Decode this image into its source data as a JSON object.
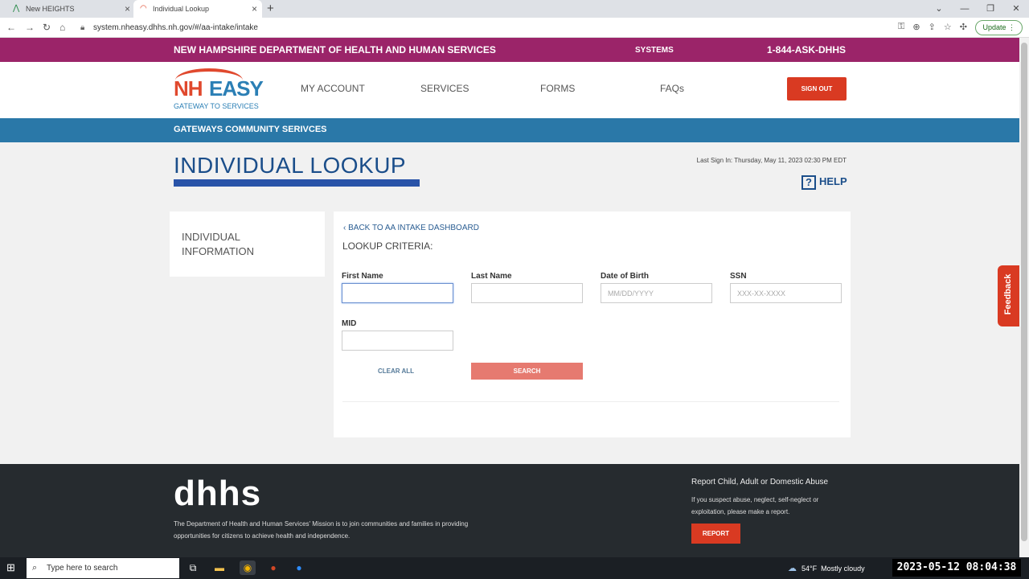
{
  "browser": {
    "tabs": [
      {
        "title": "New HEIGHTS"
      },
      {
        "title": "Individual Lookup"
      }
    ],
    "new_tab": "+",
    "url": "system.nheasy.dhhs.nh.gov/#/aa-intake/intake",
    "update_label": "Update"
  },
  "site": {
    "department": "NEW HAMPSHIRE DEPARTMENT OF HEALTH AND HUMAN SERVICES",
    "systems": "SYSTEMS",
    "phone": "1-844-ASK-DHHS",
    "logo": {
      "nh": "NH",
      "easy": "EASY",
      "tagline": "GATEWAY TO SERVICES"
    },
    "nav": [
      "MY ACCOUNT",
      "SERVICES",
      "FORMS",
      "FAQs"
    ],
    "sign_out": "SIGN OUT",
    "sub_banner": "GATEWAYS COMMUNITY SERIVCES"
  },
  "page": {
    "title": "INDIVIDUAL LOOKUP",
    "last_sign_in": "Last Sign In: Thursday, May 11, 2023 02:30 PM EDT",
    "help": "HELP",
    "sidebar_item": "INDIVIDUAL INFORMATION",
    "back_link": "BACK TO AA INTAKE DASHBOARD",
    "criteria_heading": "LOOKUP CRITERIA:",
    "fields": {
      "first_name": {
        "label": "First Name",
        "value": "",
        "placeholder": ""
      },
      "last_name": {
        "label": "Last Name",
        "value": "",
        "placeholder": ""
      },
      "dob": {
        "label": "Date of Birth",
        "value": "",
        "placeholder": "MM/DD/YYYY"
      },
      "ssn": {
        "label": "SSN",
        "value": "",
        "placeholder": "XXX-XX-XXXX"
      },
      "mid": {
        "label": "MID",
        "value": "",
        "placeholder": ""
      }
    },
    "clear_all": "CLEAR ALL",
    "search": "SEARCH",
    "feedback": "Feedback"
  },
  "footer": {
    "brand": "dhhs",
    "mission": "The Department of Health and Human Services' Mission is to join communities and families in providing opportunities for citizens to achieve health and independence.",
    "report_title": "Report Child, Adult or Domestic Abuse",
    "report_text": "If you suspect abuse, neglect, self-neglect or exploitation, please make a report.",
    "report_button": "REPORT"
  },
  "taskbar": {
    "search_placeholder": "Type here to search",
    "weather_temp": "54°F",
    "weather_desc": "Mostly cloudy",
    "clock": "2023-05-12 08:04:38"
  },
  "colors": {
    "magenta_bar": "#9b2469",
    "blue_bar": "#2a78a8",
    "accent_red": "#d93a22",
    "title_blue": "#1b4e8a"
  }
}
